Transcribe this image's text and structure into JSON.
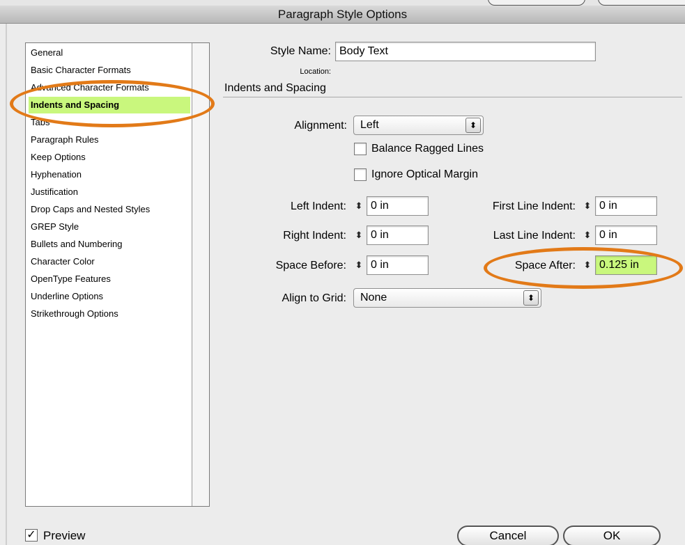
{
  "dialog": {
    "title": "Paragraph Style Options"
  },
  "sidebar": {
    "items": [
      {
        "label": "General"
      },
      {
        "label": "Basic Character Formats"
      },
      {
        "label": "Advanced Character Formats"
      },
      {
        "label": "Indents and Spacing",
        "selected": true
      },
      {
        "label": "Tabs"
      },
      {
        "label": "Paragraph Rules"
      },
      {
        "label": "Keep Options"
      },
      {
        "label": "Hyphenation"
      },
      {
        "label": "Justification"
      },
      {
        "label": "Drop Caps and Nested Styles"
      },
      {
        "label": "GREP Style"
      },
      {
        "label": "Bullets and Numbering"
      },
      {
        "label": "Character Color"
      },
      {
        "label": "OpenType Features"
      },
      {
        "label": "Underline Options"
      },
      {
        "label": "Strikethrough Options"
      }
    ]
  },
  "form": {
    "style_name_label": "Style Name:",
    "style_name_value": "Body Text",
    "location_label": "Location:",
    "section_title": "Indents and Spacing",
    "alignment_label": "Alignment:",
    "alignment_value": "Left",
    "balance_ragged_label": "Balance Ragged Lines",
    "ignore_optical_label": "Ignore Optical Margin",
    "left_indent_label": "Left Indent:",
    "left_indent_value": "0 in",
    "right_indent_label": "Right Indent:",
    "right_indent_value": "0 in",
    "space_before_label": "Space Before:",
    "space_before_value": "0 in",
    "first_line_indent_label": "First Line Indent:",
    "first_line_indent_value": "0 in",
    "last_line_indent_label": "Last Line Indent:",
    "last_line_indent_value": "0 in",
    "space_after_label": "Space After:",
    "space_after_value": "0.125 in",
    "align_to_grid_label": "Align to Grid:",
    "align_to_grid_value": "None"
  },
  "footer": {
    "preview_label": "Preview",
    "preview_checked": true,
    "cancel_label": "Cancel",
    "ok_label": "OK"
  },
  "colors": {
    "selection_highlight": "#c9f77d",
    "annotation_oval": "#e27a18"
  },
  "icons": {
    "spinner": "up-down-arrows-icon",
    "popup": "popup-arrows-icon",
    "check": "checkmark-icon"
  }
}
